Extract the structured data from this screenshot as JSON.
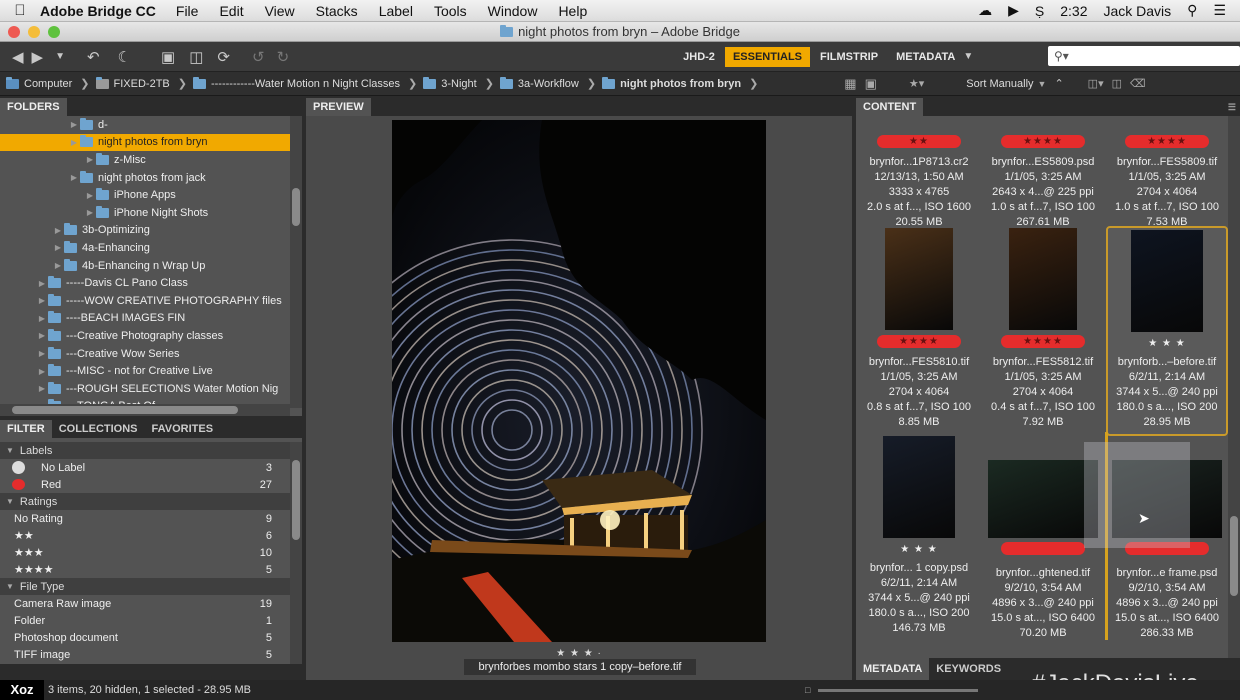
{
  "menubar": {
    "app_name": "Adobe Bridge CC",
    "items": [
      "File",
      "Edit",
      "View",
      "Stacks",
      "Label",
      "Tools",
      "Window",
      "Help"
    ],
    "time": "2:32",
    "user": "Jack Davis"
  },
  "window": {
    "title": "night photos from bryn – Adobe Bridge"
  },
  "toolbar": {
    "workspaces": [
      "JHD-2",
      "ESSENTIALS",
      "FILMSTRIP",
      "METADATA"
    ],
    "active_workspace": "ESSENTIALS",
    "search_placeholder": "",
    "accent": "#f1a900"
  },
  "path": {
    "crumbs": [
      "Computer",
      "FIXED-2TB",
      "------------Water Motion n Night Classes",
      "3-Night",
      "3a-Workflow",
      "night photos from bryn"
    ],
    "sort_label": "Sort Manually"
  },
  "folders": {
    "tab_label": "FOLDERS",
    "items": [
      {
        "label": "d-",
        "indent": 3,
        "selected": false
      },
      {
        "label": "night photos from bryn",
        "indent": 3,
        "selected": true
      },
      {
        "label": "z-Misc",
        "indent": 4,
        "selected": false
      },
      {
        "label": "night photos from jack",
        "indent": 3,
        "selected": false
      },
      {
        "label": "iPhone Apps",
        "indent": 4,
        "selected": false
      },
      {
        "label": "iPhone Night Shots",
        "indent": 4,
        "selected": false
      },
      {
        "label": "3b-Optimizing",
        "indent": 2,
        "selected": false
      },
      {
        "label": "4a-Enhancing",
        "indent": 2,
        "selected": false
      },
      {
        "label": "4b-Enhancing n Wrap Up",
        "indent": 2,
        "selected": false
      },
      {
        "label": "-----Davis CL Pano Class",
        "indent": 1,
        "selected": false
      },
      {
        "label": "-----WOW CREATIVE PHOTOGRAPHY files",
        "indent": 1,
        "selected": false
      },
      {
        "label": "----BEACH IMAGES FIN",
        "indent": 1,
        "selected": false
      },
      {
        "label": "---Creative Photography classes",
        "indent": 1,
        "selected": false
      },
      {
        "label": "---Creative Wow Series",
        "indent": 1,
        "selected": false
      },
      {
        "label": "---MISC - not for Creative Live",
        "indent": 1,
        "selected": false
      },
      {
        "label": "---ROUGH SELECTIONS Water Motion Nig",
        "indent": 1,
        "selected": false
      },
      {
        "label": "---TONGA Best Of",
        "indent": 1,
        "selected": false
      }
    ]
  },
  "filter": {
    "tabs": [
      "FILTER",
      "COLLECTIONS",
      "FAVORITES"
    ],
    "groups": [
      {
        "title": "Labels",
        "rows": [
          {
            "label": "No Label",
            "count": "3"
          },
          {
            "label": "Red",
            "count": "27"
          }
        ]
      },
      {
        "title": "Ratings",
        "rows": [
          {
            "label": "No Rating",
            "count": "9"
          },
          {
            "label": "★★",
            "count": "6"
          },
          {
            "label": "★★★",
            "count": "10"
          },
          {
            "label": "★★★★",
            "count": "5"
          }
        ]
      },
      {
        "title": "File Type",
        "rows": [
          {
            "label": "Camera Raw image",
            "count": "19"
          },
          {
            "label": "Folder",
            "count": "1"
          },
          {
            "label": "Photoshop document",
            "count": "5"
          },
          {
            "label": "TIFF image",
            "count": "5"
          }
        ]
      }
    ]
  },
  "preview": {
    "tab_label": "PREVIEW",
    "rating": "★ ★ ★ ·",
    "filename": "brynforbes  mombo stars 1 copy–before.tif"
  },
  "content": {
    "tab_label": "CONTENT",
    "items": [
      {
        "rating": "★★",
        "name": "brynfor...1P8713.cr2",
        "date": "12/13/13, 1:50 AM",
        "dims": "3333 x 4765",
        "exp": "2.0 s at f..., ISO 1600",
        "size": "20.55 MB"
      },
      {
        "rating": "★★★★",
        "name": "brynfor...ES5809.psd",
        "date": "1/1/05, 3:25 AM",
        "dims": "2643 x 4...@ 225 ppi",
        "exp": "1.0 s at f...7, ISO 100",
        "size": "267.61 MB"
      },
      {
        "rating": "★★★★",
        "name": "brynfor...FES5809.tif",
        "date": "1/1/05, 3:25 AM",
        "dims": "2704 x 4064",
        "exp": "1.0 s at f...7, ISO 100",
        "size": "7.53 MB"
      },
      {
        "rating": "★★★★",
        "name": "brynfor...FES5810.tif",
        "date": "1/1/05, 3:25 AM",
        "dims": "2704 x 4064",
        "exp": "0.8 s at f...7, ISO 100",
        "size": "8.85 MB"
      },
      {
        "rating": "★★★★",
        "name": "brynfor...FES5812.tif",
        "date": "1/1/05, 3:25 AM",
        "dims": "2704 x 4064",
        "exp": "0.4 s at f...7, ISO 100",
        "size": "7.92 MB"
      },
      {
        "rating": "★ ★ ★",
        "name": "brynforb...–before.tif",
        "date": "6/2/11, 2:14 AM",
        "dims": "3744 x 5...@ 240 ppi",
        "exp": "180.0 s a..., ISO 200",
        "size": "28.95 MB"
      },
      {
        "rating": "★ ★ ★",
        "name": "brynfor... 1 copy.psd",
        "date": "6/2/11, 2:14 AM",
        "dims": "3744 x 5...@ 240 ppi",
        "exp": "180.0 s a..., ISO 200",
        "size": "146.73 MB"
      },
      {
        "rating": "",
        "name": "brynfor...ghtened.tif",
        "date": "9/2/10, 3:54 AM",
        "dims": "4896 x 3...@ 240 ppi",
        "exp": "15.0 s at..., ISO 6400",
        "size": "70.20 MB"
      },
      {
        "rating": "",
        "name": "brynfor...e frame.psd",
        "date": "9/2/10, 3:54 AM",
        "dims": "4896 x 3...@ 240 ppi",
        "exp": "15.0 s at..., ISO 6400",
        "size": "286.33 MB"
      }
    ]
  },
  "meta_tabs": [
    "METADATA",
    "KEYWORDS"
  ],
  "status": {
    "text": "3 items, 20 hidden, 1 selected - 28.95 MB"
  },
  "watermark": "#JackDavisLive",
  "corner_logo": "Xoz"
}
